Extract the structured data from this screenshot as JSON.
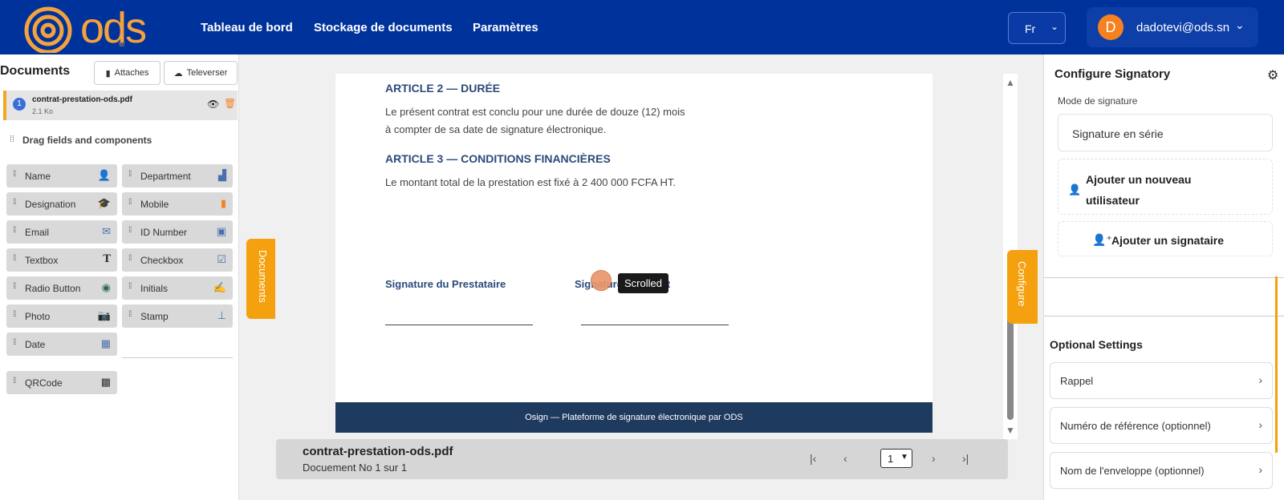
{
  "header": {
    "logo_text": "ods",
    "logo_mark": "®",
    "nav": [
      "Tableau de bord",
      "Stockage de documents",
      "Paramètres"
    ],
    "language": "Fr",
    "user_initial": "D",
    "user_email": "dadotevi@ods.sn"
  },
  "left_panel": {
    "title": "Documents",
    "attach_label": "Attaches",
    "upload_label": "Televerser",
    "document": {
      "number": "1",
      "name": "contrat-prestation-ods.pdf",
      "size": "2.1 Ko"
    },
    "drag_title": "Drag fields and components",
    "fields": [
      {
        "label": "Name",
        "icon": "person-icon"
      },
      {
        "label": "Department",
        "icon": "building-icon"
      },
      {
        "label": "Designation",
        "icon": "graduation-icon"
      },
      {
        "label": "Mobile",
        "icon": "mobile-icon"
      },
      {
        "label": "Email",
        "icon": "envelope-icon"
      },
      {
        "label": "ID Number",
        "icon": "id-card-icon"
      },
      {
        "label": "Textbox",
        "icon": "text-icon"
      },
      {
        "label": "Checkbox",
        "icon": "checkbox-icon"
      },
      {
        "label": "Radio Button",
        "icon": "radio-icon"
      },
      {
        "label": "Initials",
        "icon": "signature-icon"
      },
      {
        "label": "Photo",
        "icon": "camera-icon"
      },
      {
        "label": "Stamp",
        "icon": "stamp-icon"
      },
      {
        "label": "Date",
        "icon": "calendar-icon"
      },
      {
        "label": "QRCode",
        "icon": "qrcode-icon"
      }
    ],
    "side_tab": "Documents"
  },
  "document": {
    "article2_title": "ARTICLE 2 — DURÉE",
    "article2_line1": "Le présent contrat est conclu pour une durée de douze (12) mois",
    "article2_line2": "à compter de sa date de signature électronique.",
    "article3_title": "ARTICLE 3 — CONDITIONS FINANCIÈRES",
    "article3_line1": "Le montant total de la prestation est fixé à 2 400 000 FCFA HT.",
    "sig_left": "Signature du Prestataire",
    "sig_right": "Signature du Client",
    "footer": "Osign — Plateforme de signature électronique par ODS",
    "tooltip": "Scrolled"
  },
  "pager": {
    "file_name": "contrat-prestation-ods.pdf",
    "subtitle": "Docuement No 1 sur 1",
    "first": "|‹",
    "prev": "‹",
    "page": "1",
    "next": "›",
    "last": "›|"
  },
  "right_panel": {
    "title": "Configure Signatory",
    "side_tab": "Configure",
    "mode_label": "Mode de signature",
    "mode_value": "Signature en série",
    "add_user": "Ajouter un nouveau utilisateur",
    "add_signer": "Ajouter un signataire",
    "optional_title": "Optional Settings",
    "options": [
      "Rappel",
      "Numéro de référence (optionnel)",
      "Nom de l'enveloppe (optionnel)"
    ]
  }
}
